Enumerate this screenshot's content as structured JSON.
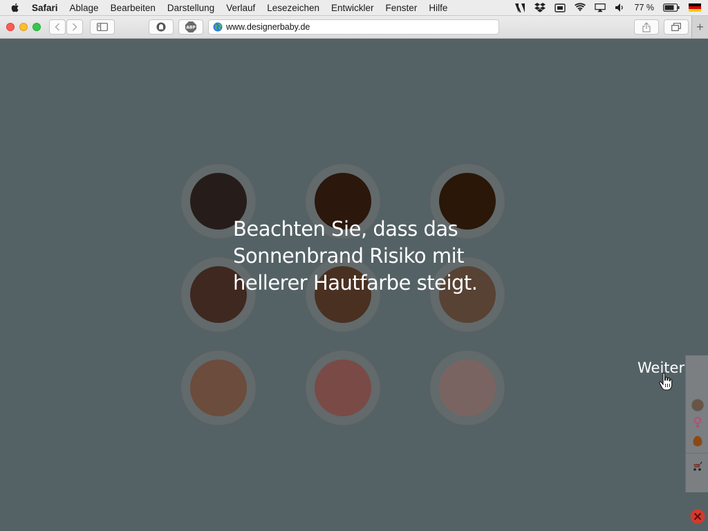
{
  "menubar": {
    "app": "Safari",
    "items": [
      "Ablage",
      "Bearbeiten",
      "Darstellung",
      "Verlauf",
      "Lesezeichen",
      "Entwickler",
      "Fenster",
      "Hilfe"
    ],
    "battery_percent": "77 %"
  },
  "browser": {
    "url": "www.designerbaby.de"
  },
  "swatches": [
    {
      "color": "#261d1a"
    },
    {
      "color": "#2b170b"
    },
    {
      "color": "#2a1708"
    },
    {
      "color": "#3f281f"
    },
    {
      "color": "#4a3020"
    },
    {
      "color": "#584234"
    },
    {
      "color": "#6b4c3d"
    },
    {
      "color": "#7a4a47"
    },
    {
      "color": "#7a6461"
    }
  ],
  "notice": {
    "line1": "Beachten Sie, dass das",
    "line2": "Sonnenbrand Risiko mit",
    "line3": "hellerer Hautfarbe steigt."
  },
  "navigation": {
    "next_label": "Weiter"
  },
  "side_panel": {
    "skin_color": "#7a5a3e",
    "gender_color": "#c0486e",
    "hair_color": "#8a4a18",
    "close_color": "#d23a2e"
  }
}
